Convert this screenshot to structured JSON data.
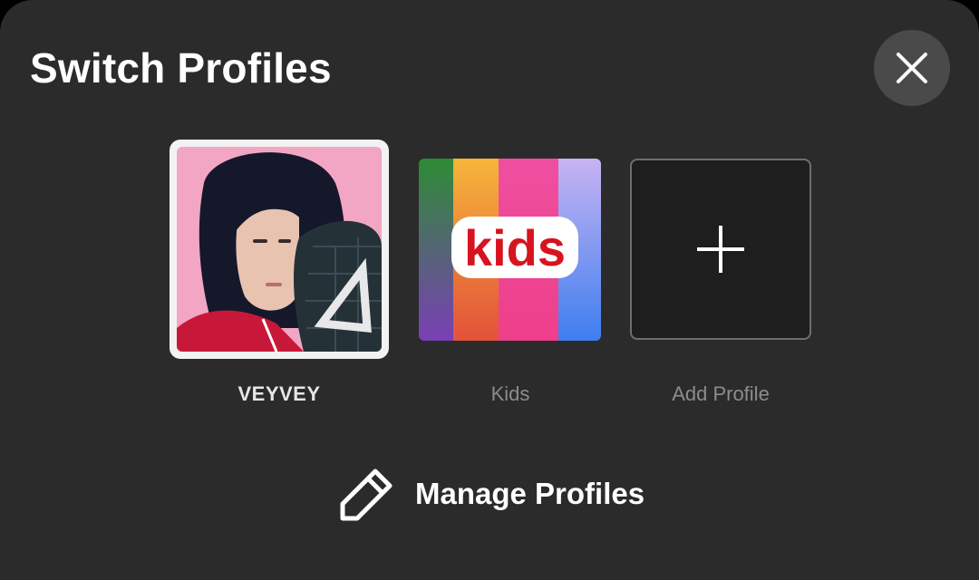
{
  "header": {
    "title": "Switch Profiles",
    "close_icon": "close-icon"
  },
  "profiles": [
    {
      "name": "VEYVEY",
      "selected": true,
      "avatar": "portrait-image"
    },
    {
      "name": "Kids",
      "selected": false,
      "avatar": "kids-avatar",
      "avatar_text": "kids"
    },
    {
      "name": "Add Profile",
      "selected": false,
      "avatar": "plus-icon"
    }
  ],
  "footer": {
    "manage_label": "Manage Profiles",
    "manage_icon": "pencil-icon"
  },
  "colors": {
    "background": "#2b2b2b",
    "text_primary": "#ffffff",
    "text_muted": "#8c8c8c",
    "selected_border": "#f2f2f2",
    "close_button_bg": "#4a4a4a",
    "kids_red": "#d6141f"
  }
}
